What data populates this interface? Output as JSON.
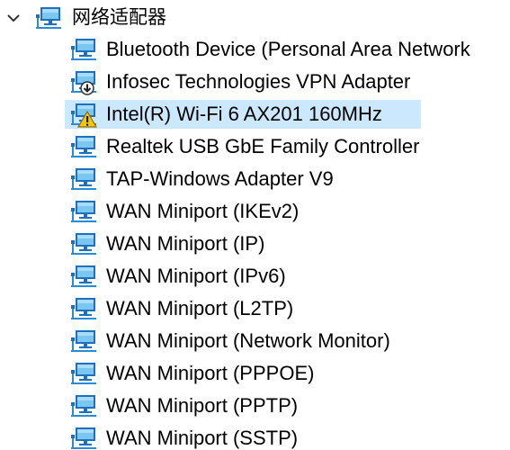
{
  "category": {
    "label": "网络适配器",
    "expanded": true,
    "icon": "network-adapter-icon"
  },
  "selection_color": "#cce8ff",
  "devices": [
    {
      "label": "Bluetooth Device (Personal Area Network",
      "icon": "network-adapter-icon",
      "status": "normal"
    },
    {
      "label": "Infosec Technologies VPN Adapter",
      "icon": "network-adapter-download-icon",
      "status": "normal"
    },
    {
      "label": "Intel(R) Wi-Fi 6 AX201 160MHz",
      "icon": "network-adapter-warning-icon",
      "status": "warning",
      "selected": true
    },
    {
      "label": "Realtek USB GbE Family Controller",
      "icon": "network-adapter-icon",
      "status": "normal"
    },
    {
      "label": "TAP-Windows Adapter V9",
      "icon": "network-adapter-icon",
      "status": "normal"
    },
    {
      "label": "WAN Miniport (IKEv2)",
      "icon": "network-adapter-icon",
      "status": "normal"
    },
    {
      "label": "WAN Miniport (IP)",
      "icon": "network-adapter-icon",
      "status": "normal"
    },
    {
      "label": "WAN Miniport (IPv6)",
      "icon": "network-adapter-icon",
      "status": "normal"
    },
    {
      "label": "WAN Miniport (L2TP)",
      "icon": "network-adapter-icon",
      "status": "normal"
    },
    {
      "label": "WAN Miniport (Network Monitor)",
      "icon": "network-adapter-icon",
      "status": "normal"
    },
    {
      "label": "WAN Miniport (PPPOE)",
      "icon": "network-adapter-icon",
      "status": "normal"
    },
    {
      "label": "WAN Miniport (PPTP)",
      "icon": "network-adapter-icon",
      "status": "normal"
    },
    {
      "label": "WAN Miniport (SSTP)",
      "icon": "network-adapter-icon",
      "status": "normal"
    }
  ]
}
